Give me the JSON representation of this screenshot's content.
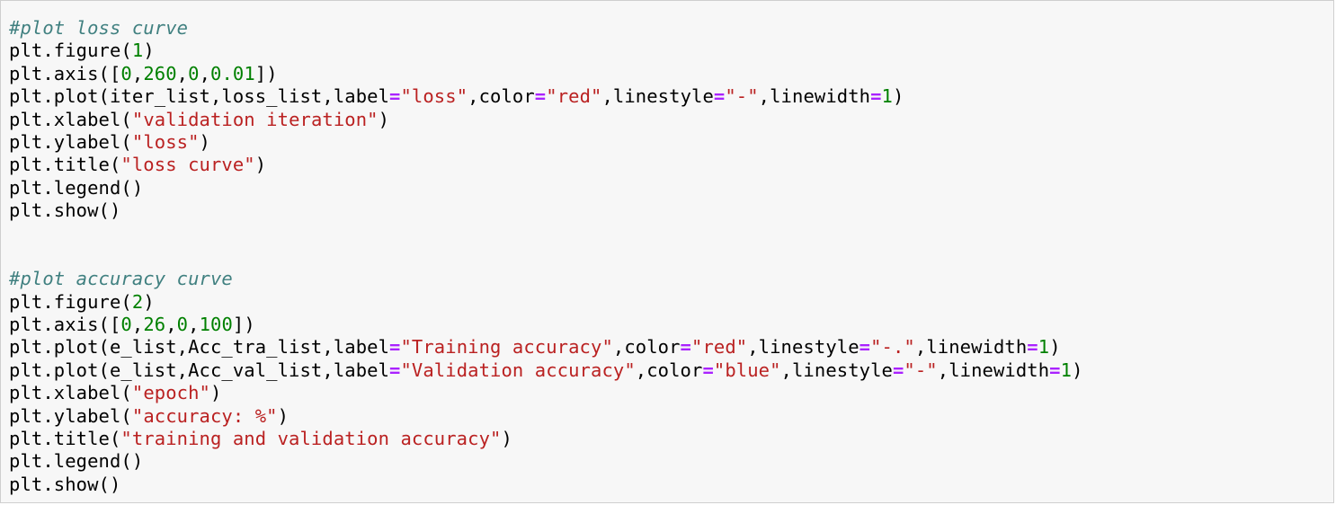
{
  "lines": [
    [
      {
        "t": "comment",
        "v": "#plot loss curve"
      }
    ],
    [
      {
        "t": "text",
        "v": "plt.figure("
      },
      {
        "t": "number",
        "v": "1"
      },
      {
        "t": "text",
        "v": ")"
      }
    ],
    [
      {
        "t": "text",
        "v": "plt.axis(["
      },
      {
        "t": "number",
        "v": "0"
      },
      {
        "t": "text",
        "v": ","
      },
      {
        "t": "number",
        "v": "260"
      },
      {
        "t": "text",
        "v": ","
      },
      {
        "t": "number",
        "v": "0"
      },
      {
        "t": "text",
        "v": ","
      },
      {
        "t": "number",
        "v": "0.01"
      },
      {
        "t": "text",
        "v": "])"
      }
    ],
    [
      {
        "t": "text",
        "v": "plt.plot(iter_list,loss_list,label"
      },
      {
        "t": "op",
        "v": "="
      },
      {
        "t": "string",
        "v": "\"loss\""
      },
      {
        "t": "text",
        "v": ",color"
      },
      {
        "t": "op",
        "v": "="
      },
      {
        "t": "string",
        "v": "\"red\""
      },
      {
        "t": "text",
        "v": ",linestyle"
      },
      {
        "t": "op",
        "v": "="
      },
      {
        "t": "string",
        "v": "\"-\""
      },
      {
        "t": "text",
        "v": ",linewidth"
      },
      {
        "t": "op",
        "v": "="
      },
      {
        "t": "number",
        "v": "1"
      },
      {
        "t": "text",
        "v": ")"
      }
    ],
    [
      {
        "t": "text",
        "v": "plt.xlabel("
      },
      {
        "t": "string",
        "v": "\"validation iteration\""
      },
      {
        "t": "text",
        "v": ")"
      }
    ],
    [
      {
        "t": "text",
        "v": "plt.ylabel("
      },
      {
        "t": "string",
        "v": "\"loss\""
      },
      {
        "t": "text",
        "v": ")"
      }
    ],
    [
      {
        "t": "text",
        "v": "plt.title("
      },
      {
        "t": "string",
        "v": "\"loss curve\""
      },
      {
        "t": "text",
        "v": ")"
      }
    ],
    [
      {
        "t": "text",
        "v": "plt.legend()"
      }
    ],
    [
      {
        "t": "text",
        "v": "plt.show()"
      }
    ],
    [],
    [],
    [
      {
        "t": "comment",
        "v": "#plot accuracy curve"
      }
    ],
    [
      {
        "t": "text",
        "v": "plt.figure("
      },
      {
        "t": "number",
        "v": "2"
      },
      {
        "t": "text",
        "v": ")"
      }
    ],
    [
      {
        "t": "text",
        "v": "plt.axis(["
      },
      {
        "t": "number",
        "v": "0"
      },
      {
        "t": "text",
        "v": ","
      },
      {
        "t": "number",
        "v": "26"
      },
      {
        "t": "text",
        "v": ","
      },
      {
        "t": "number",
        "v": "0"
      },
      {
        "t": "text",
        "v": ","
      },
      {
        "t": "number",
        "v": "100"
      },
      {
        "t": "text",
        "v": "])"
      }
    ],
    [
      {
        "t": "text",
        "v": "plt.plot(e_list,Acc_tra_list,label"
      },
      {
        "t": "op",
        "v": "="
      },
      {
        "t": "string",
        "v": "\"Training accuracy\""
      },
      {
        "t": "text",
        "v": ",color"
      },
      {
        "t": "op",
        "v": "="
      },
      {
        "t": "string",
        "v": "\"red\""
      },
      {
        "t": "text",
        "v": ",linestyle"
      },
      {
        "t": "op",
        "v": "="
      },
      {
        "t": "string",
        "v": "\"-.\""
      },
      {
        "t": "text",
        "v": ",linewidth"
      },
      {
        "t": "op",
        "v": "="
      },
      {
        "t": "number",
        "v": "1"
      },
      {
        "t": "text",
        "v": ")"
      }
    ],
    [
      {
        "t": "text",
        "v": "plt.plot(e_list,Acc_val_list,label"
      },
      {
        "t": "op",
        "v": "="
      },
      {
        "t": "string",
        "v": "\"Validation accuracy\""
      },
      {
        "t": "text",
        "v": ",color"
      },
      {
        "t": "op",
        "v": "="
      },
      {
        "t": "string",
        "v": "\"blue\""
      },
      {
        "t": "text",
        "v": ",linestyle"
      },
      {
        "t": "op",
        "v": "="
      },
      {
        "t": "string",
        "v": "\"-\""
      },
      {
        "t": "text",
        "v": ",linewidth"
      },
      {
        "t": "op",
        "v": "="
      },
      {
        "t": "number",
        "v": "1"
      },
      {
        "t": "text",
        "v": ")"
      }
    ],
    [
      {
        "t": "text",
        "v": "plt.xlabel("
      },
      {
        "t": "string",
        "v": "\"epoch\""
      },
      {
        "t": "text",
        "v": ")"
      }
    ],
    [
      {
        "t": "text",
        "v": "plt.ylabel("
      },
      {
        "t": "string",
        "v": "\"accuracy: %\""
      },
      {
        "t": "text",
        "v": ")"
      }
    ],
    [
      {
        "t": "text",
        "v": "plt.title("
      },
      {
        "t": "string",
        "v": "\"training and validation accuracy\""
      },
      {
        "t": "text",
        "v": ")"
      }
    ],
    [
      {
        "t": "text",
        "v": "plt.legend()"
      }
    ],
    [
      {
        "t": "text",
        "v": "plt.show()"
      }
    ]
  ],
  "colors": {
    "background": "#f7f7f7",
    "border": "#cfcfcf",
    "comment": "#408080",
    "string": "#ba2121",
    "number": "#008000",
    "operator": "#aa22ff",
    "text": "#000000"
  }
}
